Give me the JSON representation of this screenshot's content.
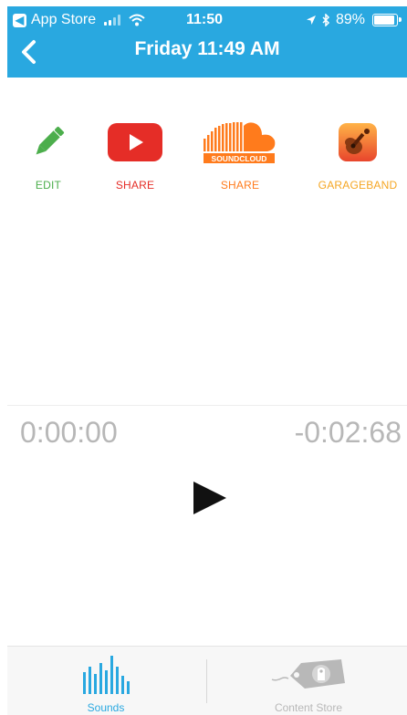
{
  "status_bar": {
    "back_app": "App Store",
    "time": "11:50",
    "battery": "89%",
    "battery_level": 0.89,
    "signal_bars_on": 2,
    "signal_bars_total": 4
  },
  "nav": {
    "title": "Friday 11:49 AM",
    "back_icon": "chevron-left-icon"
  },
  "actions": [
    {
      "label": "EDIT",
      "icon": "pencil-icon",
      "color": "#4cae4c"
    },
    {
      "label": "SHARE",
      "icon": "youtube-icon",
      "color": "#e52d27"
    },
    {
      "label": "SHARE",
      "icon": "soundcloud-icon",
      "icon_text": "SOUNDCLOUD",
      "color": "#ff7b1c"
    },
    {
      "label": "GARAGEBAND",
      "icon": "garageband-icon",
      "color": "#f5a623"
    }
  ],
  "player": {
    "elapsed": "0:00:00",
    "remaining": "-0:02:68",
    "play_icon": "play-icon"
  },
  "tab_bar": {
    "tabs": [
      {
        "label": "Sounds",
        "icon": "sounds-bars-icon",
        "active": true,
        "color": "#29a8e0"
      },
      {
        "label": "Content Store",
        "icon": "price-tag-icon",
        "active": false,
        "color": "#b8b8b8"
      }
    ]
  },
  "colors": {
    "accent": "#29a8e0",
    "time_text": "#b7b7b7"
  }
}
